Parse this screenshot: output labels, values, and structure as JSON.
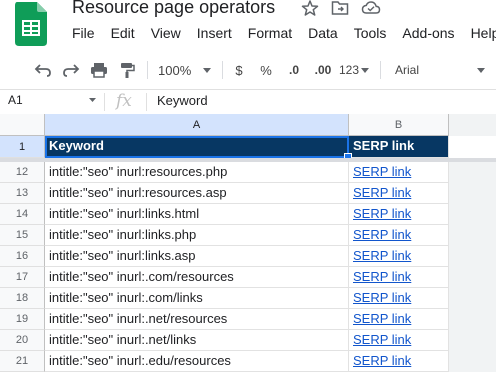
{
  "doc": {
    "title": "Resource page operators"
  },
  "menu": [
    "File",
    "Edit",
    "View",
    "Insert",
    "Format",
    "Data",
    "Tools",
    "Add-ons",
    "Help"
  ],
  "toolbar": {
    "zoom": "100%",
    "currency": "$",
    "percent": "%",
    "dec_less": ".0",
    "dec_more": ".00",
    "more_formats": "123",
    "font": "Arial"
  },
  "formula_bar": {
    "cell_ref": "A1",
    "fx": "fx",
    "content": "Keyword"
  },
  "grid": {
    "columns": [
      "A",
      "B"
    ],
    "header_row": {
      "num": "1",
      "cells": [
        "Keyword",
        "SERP link"
      ]
    },
    "rows": [
      {
        "num": "12",
        "keyword": "intitle:\"seo\" inurl:resources.php",
        "link": "SERP link"
      },
      {
        "num": "13",
        "keyword": "intitle:\"seo\" inurl:resources.asp",
        "link": "SERP link"
      },
      {
        "num": "14",
        "keyword": "intitle:\"seo\" inurl:links.html",
        "link": "SERP link"
      },
      {
        "num": "15",
        "keyword": "intitle:\"seo\" inurl:links.php",
        "link": "SERP link"
      },
      {
        "num": "16",
        "keyword": "intitle:\"seo\" inurl:links.asp",
        "link": "SERP link"
      },
      {
        "num": "17",
        "keyword": "intitle:\"seo\" inurl:.com/resources",
        "link": "SERP link"
      },
      {
        "num": "18",
        "keyword": "intitle:\"seo\" inurl:.com/links",
        "link": "SERP link"
      },
      {
        "num": "19",
        "keyword": "intitle:\"seo\" inurl:.net/resources",
        "link": "SERP link"
      },
      {
        "num": "20",
        "keyword": "intitle:\"seo\" inurl:.net/links",
        "link": "SERP link"
      },
      {
        "num": "21",
        "keyword": "intitle:\"seo\" inurl:.edu/resources",
        "link": "SERP link"
      }
    ]
  },
  "colors": {
    "header_fill": "#073763",
    "link": "#1155cc",
    "selection": "#1a73e8",
    "sheets_green": "#0f9d58"
  }
}
